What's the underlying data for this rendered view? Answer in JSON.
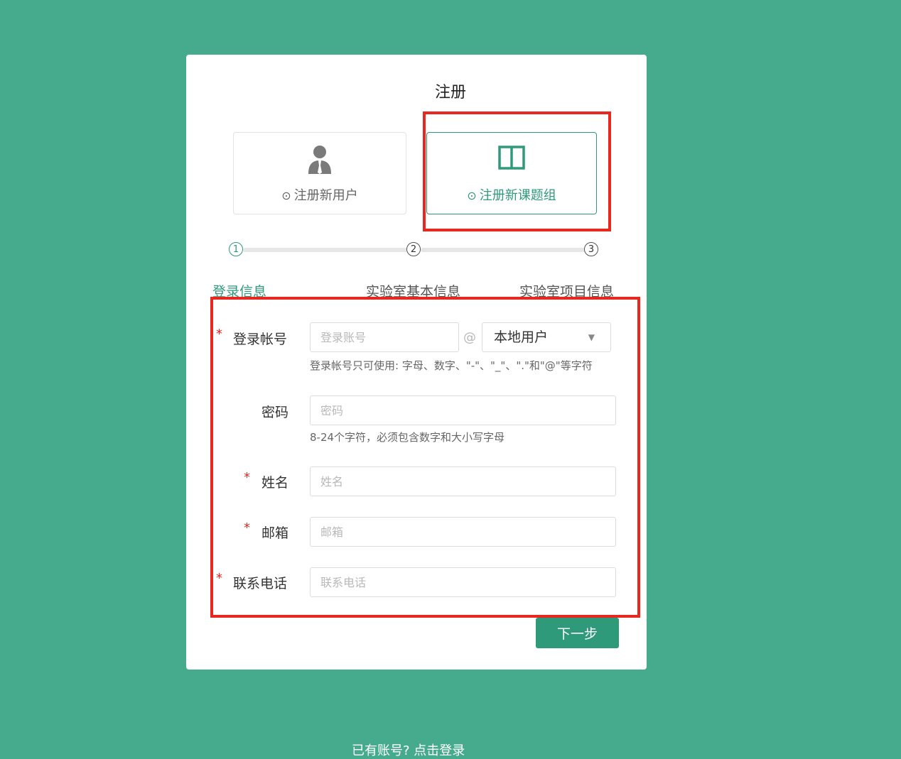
{
  "page": {
    "title": "注册",
    "login_link": "已有账号? 点击登录"
  },
  "register_types": [
    {
      "label": "注册新用户",
      "icon": "user-icon",
      "selected": false
    },
    {
      "label": "注册新课题组",
      "icon": "book-icon",
      "selected": true
    }
  ],
  "steps": {
    "numbers": [
      "①",
      "②",
      "③"
    ],
    "titles": [
      "登录信息",
      "实验室基本信息",
      "实验室项目信息"
    ],
    "active_index": 0
  },
  "form": {
    "account": {
      "label": "登录帐号",
      "required": "*",
      "placeholder": "登录账号",
      "at": "@",
      "domain_value": "本地用户",
      "hint": "登录帐号只可使用: 字母、数字、\"-\"、\"_\"、\".\"和\"@\"等字符"
    },
    "password": {
      "label": "密码",
      "placeholder": "密码",
      "hint": "8-24个字符，必须包含数字和大小写字母"
    },
    "name": {
      "label": "姓名",
      "required": "*",
      "placeholder": "姓名"
    },
    "email": {
      "label": "邮箱",
      "required": "*",
      "placeholder": "邮箱"
    },
    "phone": {
      "label": "联系电话",
      "required": "*",
      "placeholder": "联系电话"
    },
    "next_button": "下一步"
  },
  "colors": {
    "background": "#46ab8d",
    "accent": "#2f9a7a",
    "highlight_box": "#e8271f"
  }
}
